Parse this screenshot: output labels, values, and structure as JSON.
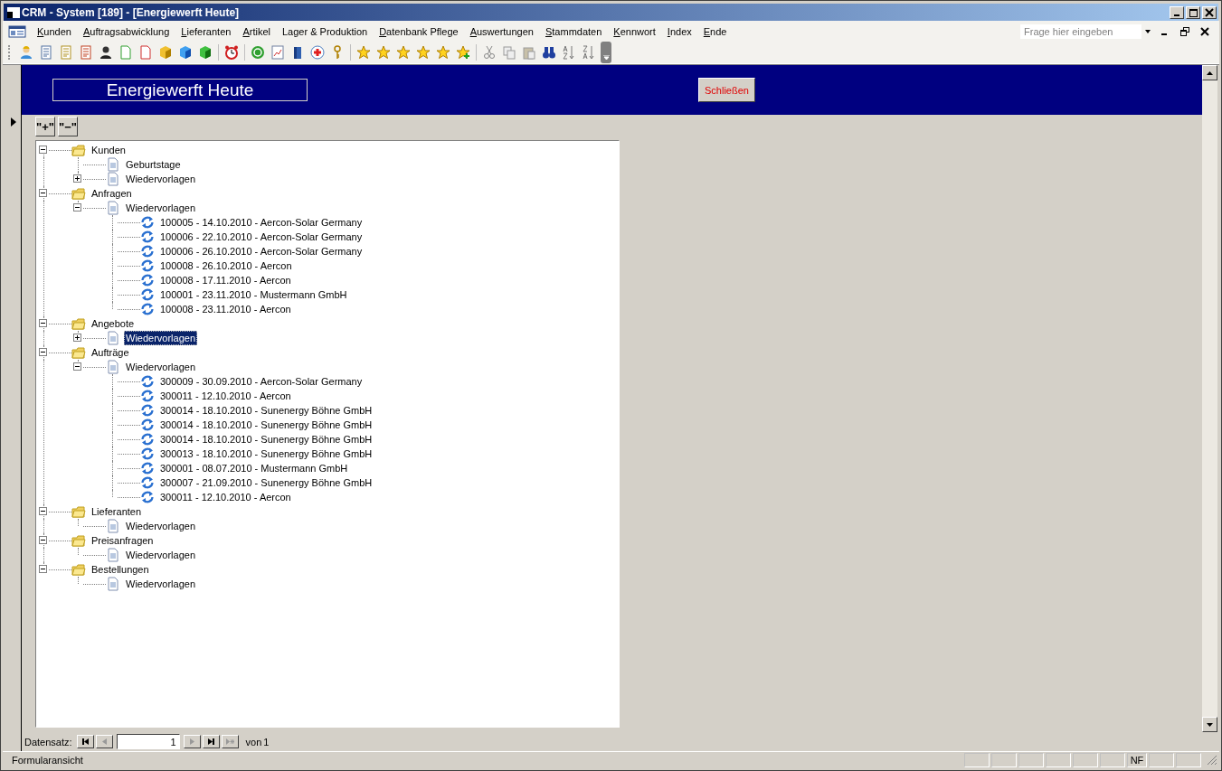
{
  "window": {
    "title": "CRM - System [189] - [Energiewerft Heute]"
  },
  "menu": [
    {
      "label": "Kunden",
      "accel": true
    },
    {
      "label": "Auftragsabwicklung",
      "accel": true
    },
    {
      "label": "Lieferanten",
      "accel": true
    },
    {
      "label": "Artikel",
      "accel": true
    },
    {
      "label": "Lager & Produktion",
      "accel": false
    },
    {
      "label": "Datenbank Pflege",
      "accel": true
    },
    {
      "label": "Auswertungen",
      "accel": true
    },
    {
      "label": "Stammdaten",
      "accel": true
    },
    {
      "label": "Kennwort",
      "accel": true
    },
    {
      "label": "Index",
      "accel": true
    },
    {
      "label": "Ende",
      "accel": true
    }
  ],
  "help_search": {
    "placeholder": "Frage hier eingeben"
  },
  "form": {
    "title": "Energiewerft Heute",
    "close_button": "Schließen",
    "expand_button": "\"+\"",
    "collapse_button": "\"−\""
  },
  "tree": [
    {
      "label": "Kunden",
      "kind": "folder",
      "expanded": true,
      "selected": false,
      "children": [
        {
          "label": "Geburtstage",
          "kind": "document",
          "selected": false
        },
        {
          "label": "Wiedervorlagen",
          "kind": "document",
          "expanded": false,
          "selected": false
        }
      ]
    },
    {
      "label": "Anfragen",
      "kind": "folder",
      "expanded": true,
      "selected": false,
      "children": [
        {
          "label": "Wiedervorlagen",
          "kind": "document",
          "expanded": true,
          "selected": false,
          "children": [
            {
              "label": "100005 - 14.10.2010 - Aercon-Solar Germany",
              "kind": "record",
              "selected": false
            },
            {
              "label": "100006 - 22.10.2010 - Aercon-Solar Germany",
              "kind": "record",
              "selected": false
            },
            {
              "label": "100006 - 26.10.2010 - Aercon-Solar Germany",
              "kind": "record",
              "selected": false
            },
            {
              "label": "100008 - 26.10.2010 - Aercon",
              "kind": "record",
              "selected": false
            },
            {
              "label": "100008 - 17.11.2010 - Aercon",
              "kind": "record",
              "selected": false
            },
            {
              "label": "100001 - 23.11.2010 - Mustermann GmbH",
              "kind": "record",
              "selected": false
            },
            {
              "label": "100008 - 23.11.2010 - Aercon",
              "kind": "record",
              "selected": false
            }
          ]
        }
      ]
    },
    {
      "label": "Angebote",
      "kind": "folder",
      "expanded": true,
      "selected": false,
      "children": [
        {
          "label": "Wiedervorlagen",
          "kind": "document",
          "expanded": false,
          "selected": true
        }
      ]
    },
    {
      "label": "Aufträge",
      "kind": "folder",
      "expanded": true,
      "selected": false,
      "children": [
        {
          "label": "Wiedervorlagen",
          "kind": "document",
          "expanded": true,
          "selected": false,
          "children": [
            {
              "label": "300009 - 30.09.2010 - Aercon-Solar Germany",
              "kind": "record",
              "selected": false
            },
            {
              "label": "300011 - 12.10.2010 - Aercon",
              "kind": "record",
              "selected": false
            },
            {
              "label": "300014 - 18.10.2010 - Sunenergy Böhne GmbH",
              "kind": "record",
              "selected": false
            },
            {
              "label": "300014 - 18.10.2010 - Sunenergy Böhne GmbH",
              "kind": "record",
              "selected": false
            },
            {
              "label": "300014 - 18.10.2010 - Sunenergy Böhne GmbH",
              "kind": "record",
              "selected": false
            },
            {
              "label": "300013 - 18.10.2010 - Sunenergy Böhne GmbH",
              "kind": "record",
              "selected": false
            },
            {
              "label": "300001 - 08.07.2010 - Mustermann GmbH",
              "kind": "record",
              "selected": false
            },
            {
              "label": "300007 - 21.09.2010 - Sunenergy Böhne GmbH",
              "kind": "record",
              "selected": false
            },
            {
              "label": "300011 - 12.10.2010 - Aercon",
              "kind": "record",
              "selected": false
            }
          ]
        }
      ]
    },
    {
      "label": "Lieferanten",
      "kind": "folder",
      "expanded": true,
      "selected": false,
      "children": [
        {
          "label": "Wiedervorlagen",
          "kind": "document",
          "selected": false
        }
      ]
    },
    {
      "label": "Preisanfragen",
      "kind": "folder",
      "expanded": true,
      "selected": false,
      "children": [
        {
          "label": "Wiedervorlagen",
          "kind": "document",
          "selected": false
        }
      ]
    },
    {
      "label": "Bestellungen",
      "kind": "folder",
      "expanded": true,
      "selected": false,
      "children": [
        {
          "label": "Wiedervorlagen",
          "kind": "document",
          "selected": false
        }
      ]
    }
  ],
  "navigation": {
    "label": "Datensatz:",
    "record": "1",
    "of_label": "von",
    "total": "1"
  },
  "status_bar": {
    "text": "Formularansicht",
    "indicator": "NF"
  }
}
